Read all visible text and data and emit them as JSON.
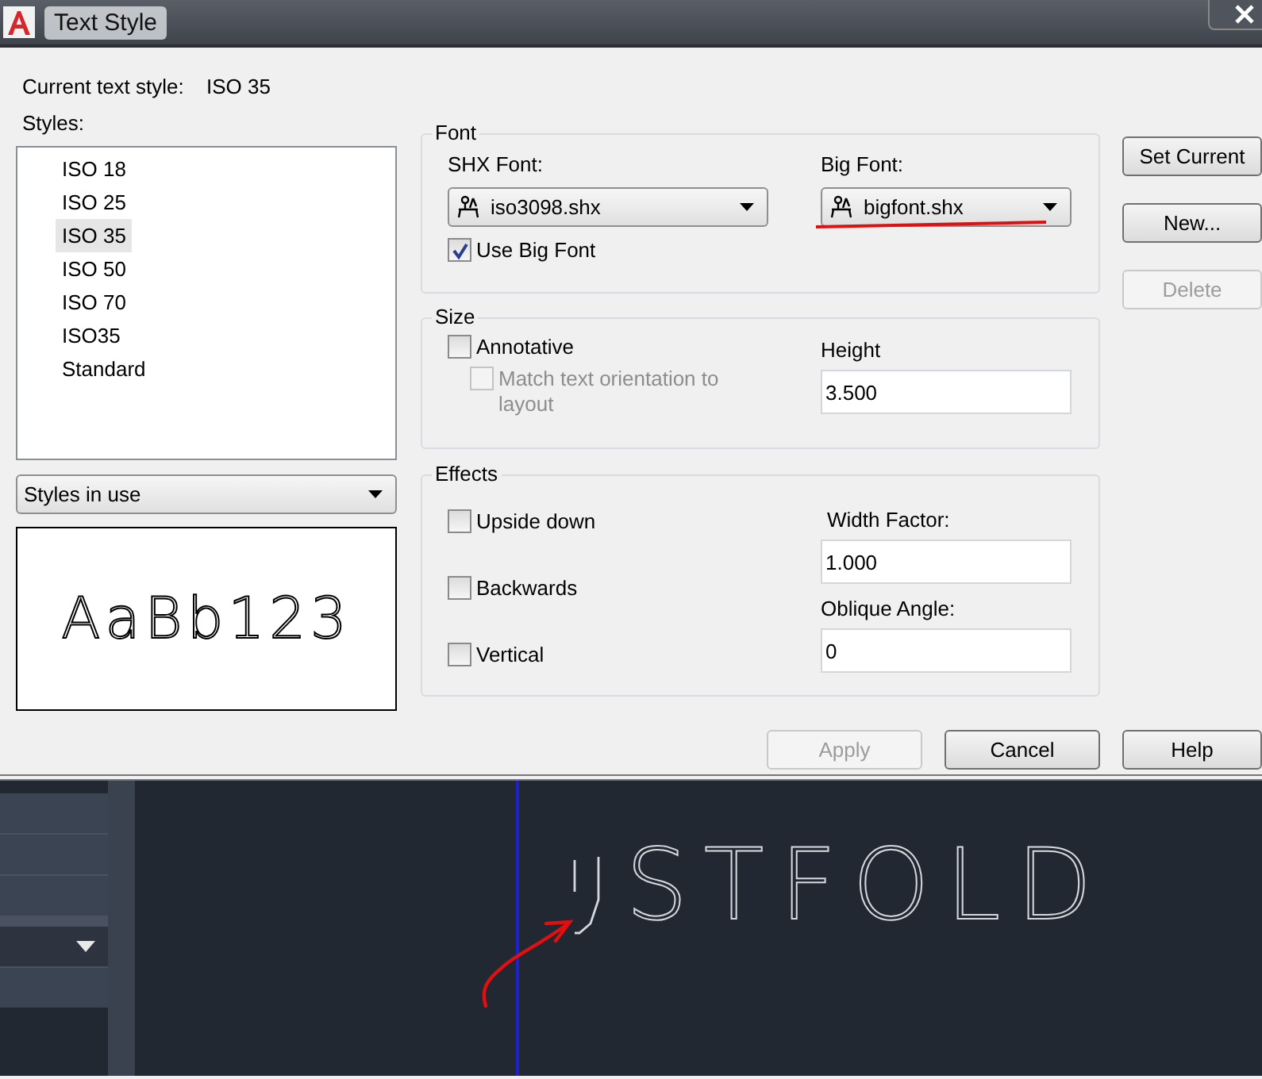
{
  "window": {
    "title": "Text Style"
  },
  "current_style": {
    "label": "Current text style:",
    "value": "ISO 35"
  },
  "styles": {
    "label": "Styles:",
    "items": [
      {
        "label": "ISO 18",
        "selected": false
      },
      {
        "label": "ISO 25",
        "selected": false
      },
      {
        "label": "ISO 35",
        "selected": true
      },
      {
        "label": "ISO 50",
        "selected": false
      },
      {
        "label": "ISO 70",
        "selected": false
      },
      {
        "label": "ISO35",
        "selected": false
      },
      {
        "label": "Standard",
        "selected": false
      }
    ]
  },
  "filter": {
    "value": "Styles in use"
  },
  "preview": {
    "sample": "AaBb123"
  },
  "font": {
    "title": "Font",
    "shx_label": "SHX Font:",
    "shx_value": "iso3098.shx",
    "big_label": "Big Font:",
    "big_value": "bigfont.shx",
    "use_big_font": {
      "label": "Use Big Font",
      "checked": true
    }
  },
  "size": {
    "title": "Size",
    "annotative": {
      "label": "Annotative",
      "checked": false
    },
    "match": {
      "label": "Match text orientation to layout",
      "checked": false,
      "disabled": true
    },
    "height_label": "Height",
    "height_value": "3.500"
  },
  "effects": {
    "title": "Effects",
    "checks": [
      {
        "label": "Upside down",
        "checked": false
      },
      {
        "label": "Backwards",
        "checked": false
      },
      {
        "label": "Vertical",
        "checked": false
      }
    ],
    "width_label": "Width Factor:",
    "width_value": "1.000",
    "oblique_label": "Oblique Angle:",
    "oblique_value": "0"
  },
  "side_buttons": [
    {
      "label": "Set Current",
      "disabled": false
    },
    {
      "label": "New...",
      "disabled": false
    },
    {
      "label": "Delete",
      "disabled": true
    }
  ],
  "bottom_buttons": [
    {
      "label": "Apply",
      "disabled": true
    },
    {
      "label": "Cancel",
      "disabled": false
    },
    {
      "label": "Help",
      "disabled": false
    }
  ],
  "drawing": {
    "text": "STFOLD"
  }
}
